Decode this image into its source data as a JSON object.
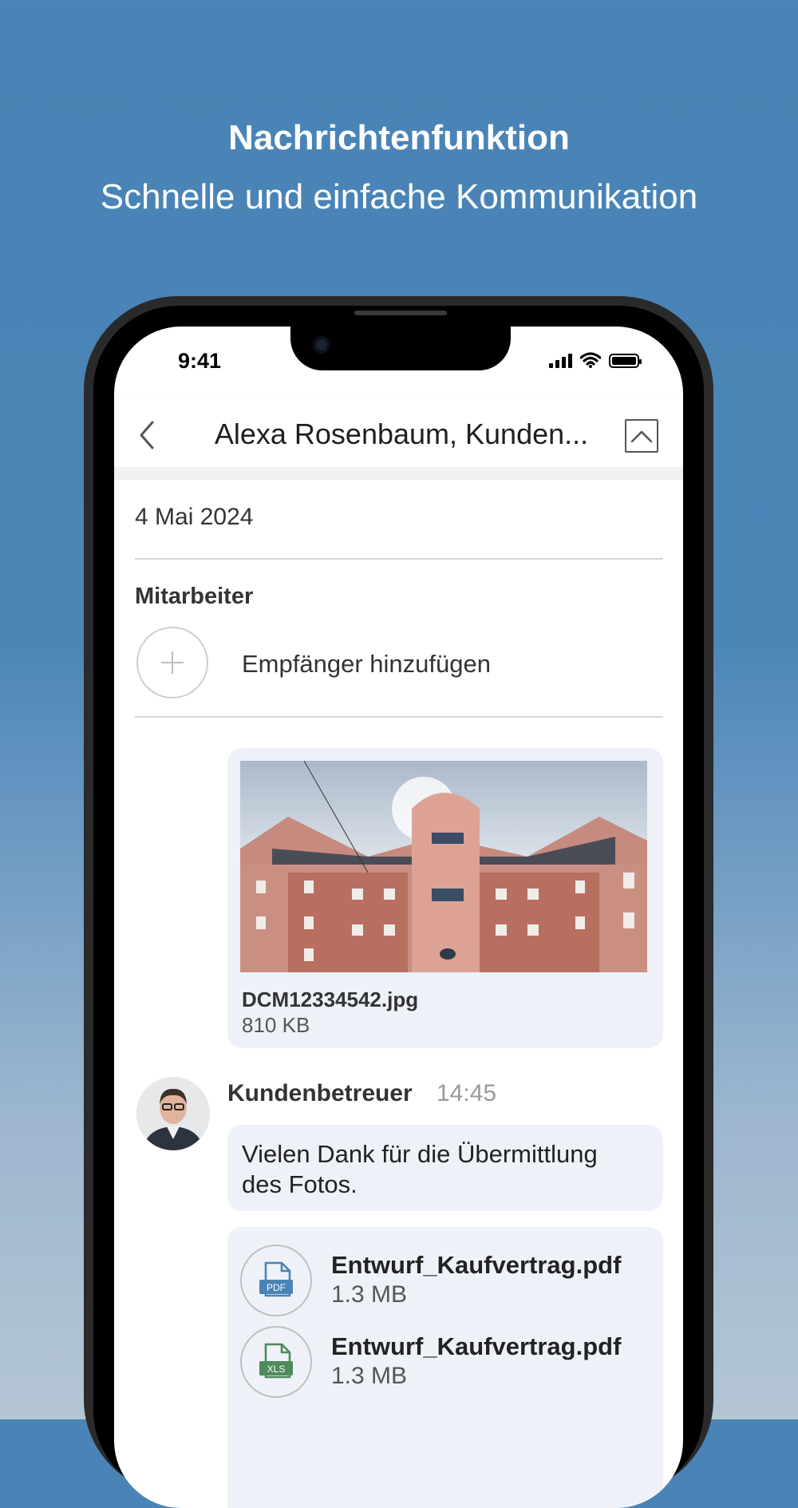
{
  "headline": {
    "title": "Nachrichtenfunktion",
    "subtitle": "Schnelle und einfache Kommunikation"
  },
  "status_bar": {
    "time": "9:41"
  },
  "nav": {
    "title": "Alexa Rosenbaum, Kunden..."
  },
  "conversation": {
    "date": "4 Mai 2024",
    "section_label": "Mitarbeiter",
    "add_recipient_label": "Empfänger hinzufügen"
  },
  "image_attachment": {
    "file_name": "DCM12334542.jpg",
    "file_size": "810 KB"
  },
  "reply": {
    "sender": "Kundenbetreuer",
    "time": "14:45",
    "text": "Vielen Dank für die Übermittlung des Fotos."
  },
  "documents": [
    {
      "icon_label": "PDF",
      "icon": "pdf-file-icon",
      "color": "#4a83b5",
      "name": "Entwurf_Kaufvertrag.pdf",
      "size": "1.3 MB"
    },
    {
      "icon_label": "XLS",
      "icon": "xls-file-icon",
      "color": "#4e8a5a",
      "name": "Entwurf_Kaufvertrag.pdf",
      "size": "1.3 MB"
    }
  ],
  "colors": {
    "background": "#4a83b5",
    "bubble": "#eef2f8"
  }
}
